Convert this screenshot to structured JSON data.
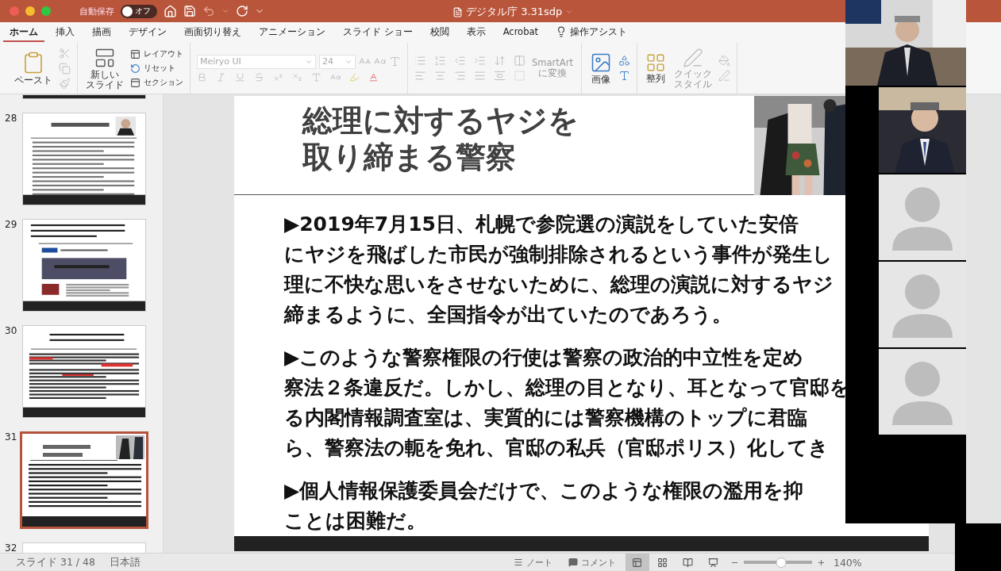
{
  "title_bar": {
    "autosave_label": "自動保存",
    "autosave": {
      "label": "オフ",
      "on": false
    },
    "document_title": "デジタル庁 3.31sdp"
  },
  "ribbon_tabs": [
    {
      "label": "ホーム",
      "selected": true
    },
    {
      "label": "挿入",
      "selected": false
    },
    {
      "label": "描画",
      "selected": false
    },
    {
      "label": "デザイン",
      "selected": false
    },
    {
      "label": "画面切り替え",
      "selected": false
    },
    {
      "label": "アニメーション",
      "selected": false
    },
    {
      "label": "スライド ショー",
      "selected": false
    },
    {
      "label": "校閲",
      "selected": false
    },
    {
      "label": "表示",
      "selected": false
    },
    {
      "label": "Acrobat",
      "selected": false
    },
    {
      "label": "操作アシスト",
      "selected": false,
      "kind": "assist"
    }
  ],
  "ribbon": {
    "paste": [
      "ペースト"
    ],
    "new_slide": [
      "新しい",
      "スライド"
    ],
    "layout": "レイアウト",
    "reset": "リセット",
    "section": "セクション",
    "font": "Meiryo UI",
    "font_size": "24",
    "smartart": [
      "SmartArt",
      "に変換"
    ],
    "picture": [
      "画像"
    ],
    "arrange": [
      "整列"
    ],
    "quick_styles": [
      "クイック",
      "スタイル"
    ]
  },
  "thumbnails": [
    {
      "kind": "cut",
      "selected": false
    },
    {
      "number": "28",
      "kind": "portrait",
      "selected": false
    },
    {
      "number": "29",
      "kind": "screenshot",
      "selected": false
    },
    {
      "number": "30",
      "kind": "marked",
      "selected": false
    },
    {
      "number": "31",
      "selected": true
    },
    {
      "number": "32",
      "kind": "blank",
      "selected": false
    }
  ],
  "slide": {
    "title": [
      "総理に対するヤジを",
      "取り締まる警察"
    ],
    "paragraphs": [
      [
        "▶2019年7月15日、札幌で参院選の演説をしていた安倍",
        "にヤジを飛ばした市民が強制排除されるという事件が発生し",
        "理に不快な思いをさせないために、総理の演説に対するヤジ",
        "締まるように、全国指令が出ていたのであろう。"
      ],
      [
        "▶このような警察権限の行使は警察の政治的中立性を定め",
        "察法２条違反だ。しかし、総理の目となり、耳となって官邸を",
        "る内閣情報調査室は、実質的には警察機構のトップに君臨",
        "ら、警察法の軛を免れ、官邸の私兵（官邸ポリス）化してき"
      ],
      [
        "▶個人情報保護委員会だけで、このような権限の濫用を抑",
        "ことは困難だ。"
      ]
    ]
  },
  "status_bar": {
    "slide_indicator": "スライド 31 / 48",
    "language": "日本語",
    "notes": "ノート",
    "comments": "コメント",
    "views": [
      {
        "kind": "normal",
        "selected": true
      },
      {
        "kind": "sorter",
        "selected": false
      },
      {
        "kind": "reading",
        "selected": false
      },
      {
        "kind": "slideshow",
        "selected": false
      }
    ],
    "zoom": {
      "level": 0.55
    },
    "zoom_label": "140%"
  },
  "video_tiles": [
    {
      "kind": "picture"
    },
    {
      "kind": "picture"
    },
    {
      "kind": "avatar"
    },
    {
      "kind": "avatar"
    },
    {
      "kind": "avatar"
    }
  ]
}
